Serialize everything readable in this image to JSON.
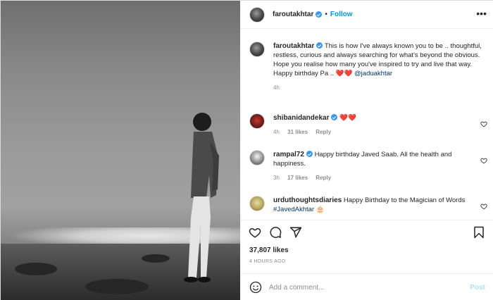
{
  "header": {
    "username": "faroutakhtar",
    "dot": "•",
    "follow_label": "Follow",
    "more_icon": "more-horizontal-icon"
  },
  "caption": {
    "username": "faroutakhtar",
    "line1": "This is how I've always known you to be .. thoughtful, restless, curious and always searching for what's beyond the obvious.",
    "line2": "Hope you realise how many you've inspired to try and live that way.",
    "line3_prefix": "Happy birthday Pa ..",
    "hearts": "❤️❤️",
    "mention": "@jaduakhtar",
    "time": "4h"
  },
  "comments": [
    {
      "username": "shibanidandekar",
      "text": "❤️❤️",
      "time": "4h",
      "likes": "31 likes",
      "reply": "Reply"
    },
    {
      "username": "rampal72",
      "text": "Happy birthday Javed Saab. All the health and happiness.",
      "time": "3h",
      "likes": "17 likes",
      "reply": "Reply"
    },
    {
      "username": "urduthoughtsdiaries",
      "text": "Happy Birthday to the Magician of Words",
      "hashtag": "#JavedAkhtar",
      "emoji": "🎂"
    }
  ],
  "actions": {
    "like_icon": "heart-icon",
    "comment_icon": "comment-icon",
    "share_icon": "share-icon",
    "save_icon": "bookmark-icon"
  },
  "likes": "37,807 likes",
  "posted_ago": "4 HOURS AGO",
  "add_comment": {
    "placeholder": "Add a comment...",
    "post_label": "Post",
    "emoji_icon": "smiley-icon"
  },
  "colors": {
    "link_blue": "#0095f6",
    "verified_blue": "#3897f0",
    "mention_navy": "#00376b",
    "muted_gray": "#8e8e8e",
    "post_disabled": "#b2dffc"
  }
}
